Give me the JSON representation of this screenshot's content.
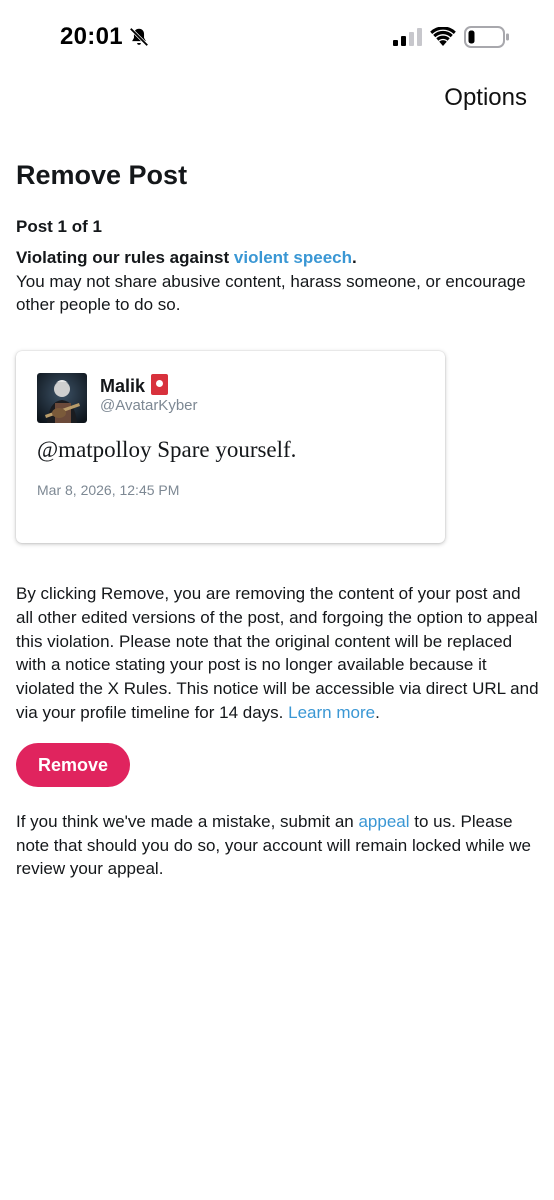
{
  "status_bar": {
    "time": "20:01",
    "icons": [
      "bell-slash-icon",
      "cellular-signal-icon",
      "wifi-icon",
      "battery-icon"
    ]
  },
  "header": {
    "options_label": "Options"
  },
  "page": {
    "title": "Remove Post",
    "post_count": "Post 1 of 1",
    "violation_lead": "Violating our rules against ",
    "violation_link": "violent speech",
    "violation_period": ".",
    "violation_desc": "You may not share abusive content, harass someone, or encourage other people to do so."
  },
  "post": {
    "author_name": "Malik",
    "handle": "@AvatarKyber",
    "text": "@matpolloy Spare yourself.",
    "date": "Mar 8, 2026, 12:45 PM"
  },
  "explanation": {
    "text": "By clicking Remove, you are removing the content of your post and all other edited versions of the post, and forgoing the option to appeal this violation. Please note that the original content will be replaced with a notice stating your post is no longer available because it violated the X Rules. This notice will be accessible via direct URL and via your profile timeline for 14 days. ",
    "learn_more": "Learn more",
    "period": "."
  },
  "remove_button": {
    "label": "Remove"
  },
  "appeal": {
    "before": "If you think we've made a mistake, submit an ",
    "link": "appeal",
    "after": " to us. Please note that should you do so, your account will remain locked while we review your appeal."
  },
  "colors": {
    "link": "#3a97d4",
    "remove_button": "#e0245e",
    "secondary_text": "#7d8893"
  }
}
